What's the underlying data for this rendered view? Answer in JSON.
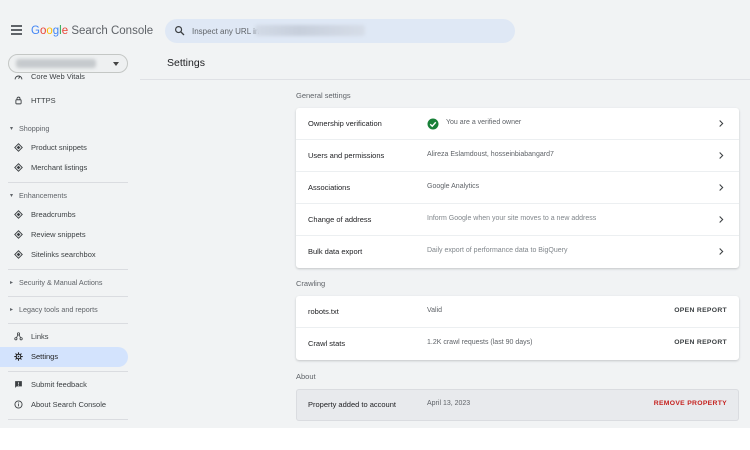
{
  "header": {
    "logo_parts": [
      "G",
      "o",
      "o",
      "g",
      "l",
      "e"
    ],
    "logo_rest": " Search Console",
    "search_placeholder": "Inspect any URL in"
  },
  "sidebar": {
    "items": [
      {
        "label": "Core Web Vitals",
        "icon": "gauge-icon"
      },
      {
        "label": "HTTPS",
        "icon": "lock-icon"
      },
      {
        "section": "Shopping"
      },
      {
        "label": "Product snippets",
        "icon": "diamond-icon"
      },
      {
        "label": "Merchant listings",
        "icon": "diamond-icon"
      },
      {
        "section": "Enhancements"
      },
      {
        "label": "Breadcrumbs",
        "icon": "diamond-icon"
      },
      {
        "label": "Review snippets",
        "icon": "diamond-icon"
      },
      {
        "label": "Sitelinks searchbox",
        "icon": "diamond-icon"
      },
      {
        "section": "Security & Manual Actions"
      },
      {
        "section": "Legacy tools and reports"
      },
      {
        "label": "Links",
        "icon": "links-icon"
      },
      {
        "label": "Settings",
        "icon": "gear-icon",
        "active": true
      },
      {
        "label": "Submit feedback",
        "icon": "feedback-icon"
      },
      {
        "label": "About Search Console",
        "icon": "info-icon"
      }
    ]
  },
  "main": {
    "title": "Settings",
    "general": {
      "heading": "General settings",
      "rows": [
        {
          "key": "Ownership verification",
          "value": "You are a verified owner"
        },
        {
          "key": "Users and permissions",
          "value": "Alireza Eslamdoust, hosseinbiabangard7"
        },
        {
          "key": "Associations",
          "value": "Google Analytics"
        },
        {
          "key": "Change of address",
          "value": "Inform Google when your site moves to a new address"
        },
        {
          "key": "Bulk data export",
          "value": "Daily export of performance data to BigQuery"
        }
      ]
    },
    "crawling": {
      "heading": "Crawling",
      "rows": [
        {
          "key": "robots.txt",
          "value": "Valid",
          "action": "OPEN REPORT"
        },
        {
          "key": "Crawl stats",
          "value": "1.2K crawl requests (last 90 days)",
          "action": "OPEN REPORT"
        }
      ]
    },
    "about": {
      "heading": "About",
      "rows": [
        {
          "key": "Property added to account",
          "value": "April 13, 2023",
          "action": "REMOVE PROPERTY"
        }
      ]
    }
  },
  "colors": {
    "accent": "#1a73e8",
    "active_nav": "#d3e3fd",
    "success": "#188038",
    "danger": "#c5221f",
    "background": "#f1f3f4"
  }
}
